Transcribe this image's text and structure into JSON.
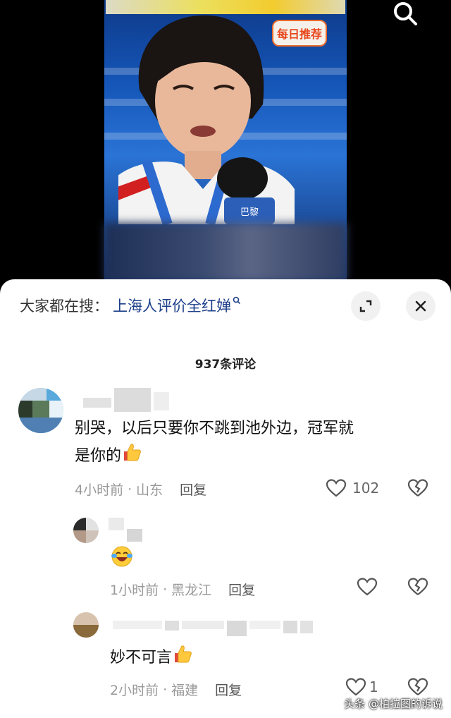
{
  "video": {
    "badge_text": "每日推荐"
  },
  "sheet": {
    "search_prefix": "大家都在搜：",
    "search_query": "上海人评价全红婵",
    "comment_count": "937条评论"
  },
  "comments": [
    {
      "text": "别哭，以后只要你不跳到池外边，冠军就是你的",
      "text_line1": "别哭，以后只要你不跳到池外边，冠军就",
      "text_line2": "是你的",
      "emoji": "thumbs-up",
      "time": "4小时前",
      "location": "山东",
      "reply": "回复",
      "likes": "102"
    },
    {
      "text": "",
      "emoji": "laughing-crying",
      "time": "1小时前",
      "location": "黑龙江",
      "reply": "回复",
      "likes": ""
    },
    {
      "text": "妙不可言",
      "emoji": "thumbs-up",
      "time": "2小时前",
      "location": "福建",
      "reply": "回复",
      "likes": "1"
    }
  ],
  "watermark": "头条 @柏拉图的诉说",
  "icons": {
    "search": "search-icon",
    "expand": "expand-icon",
    "close": "close-icon",
    "like": "heart-outline-icon",
    "dislike": "broken-heart-icon"
  },
  "colors": {
    "link": "#1e3f8a",
    "meta": "#999999",
    "background_video": "#000000"
  }
}
